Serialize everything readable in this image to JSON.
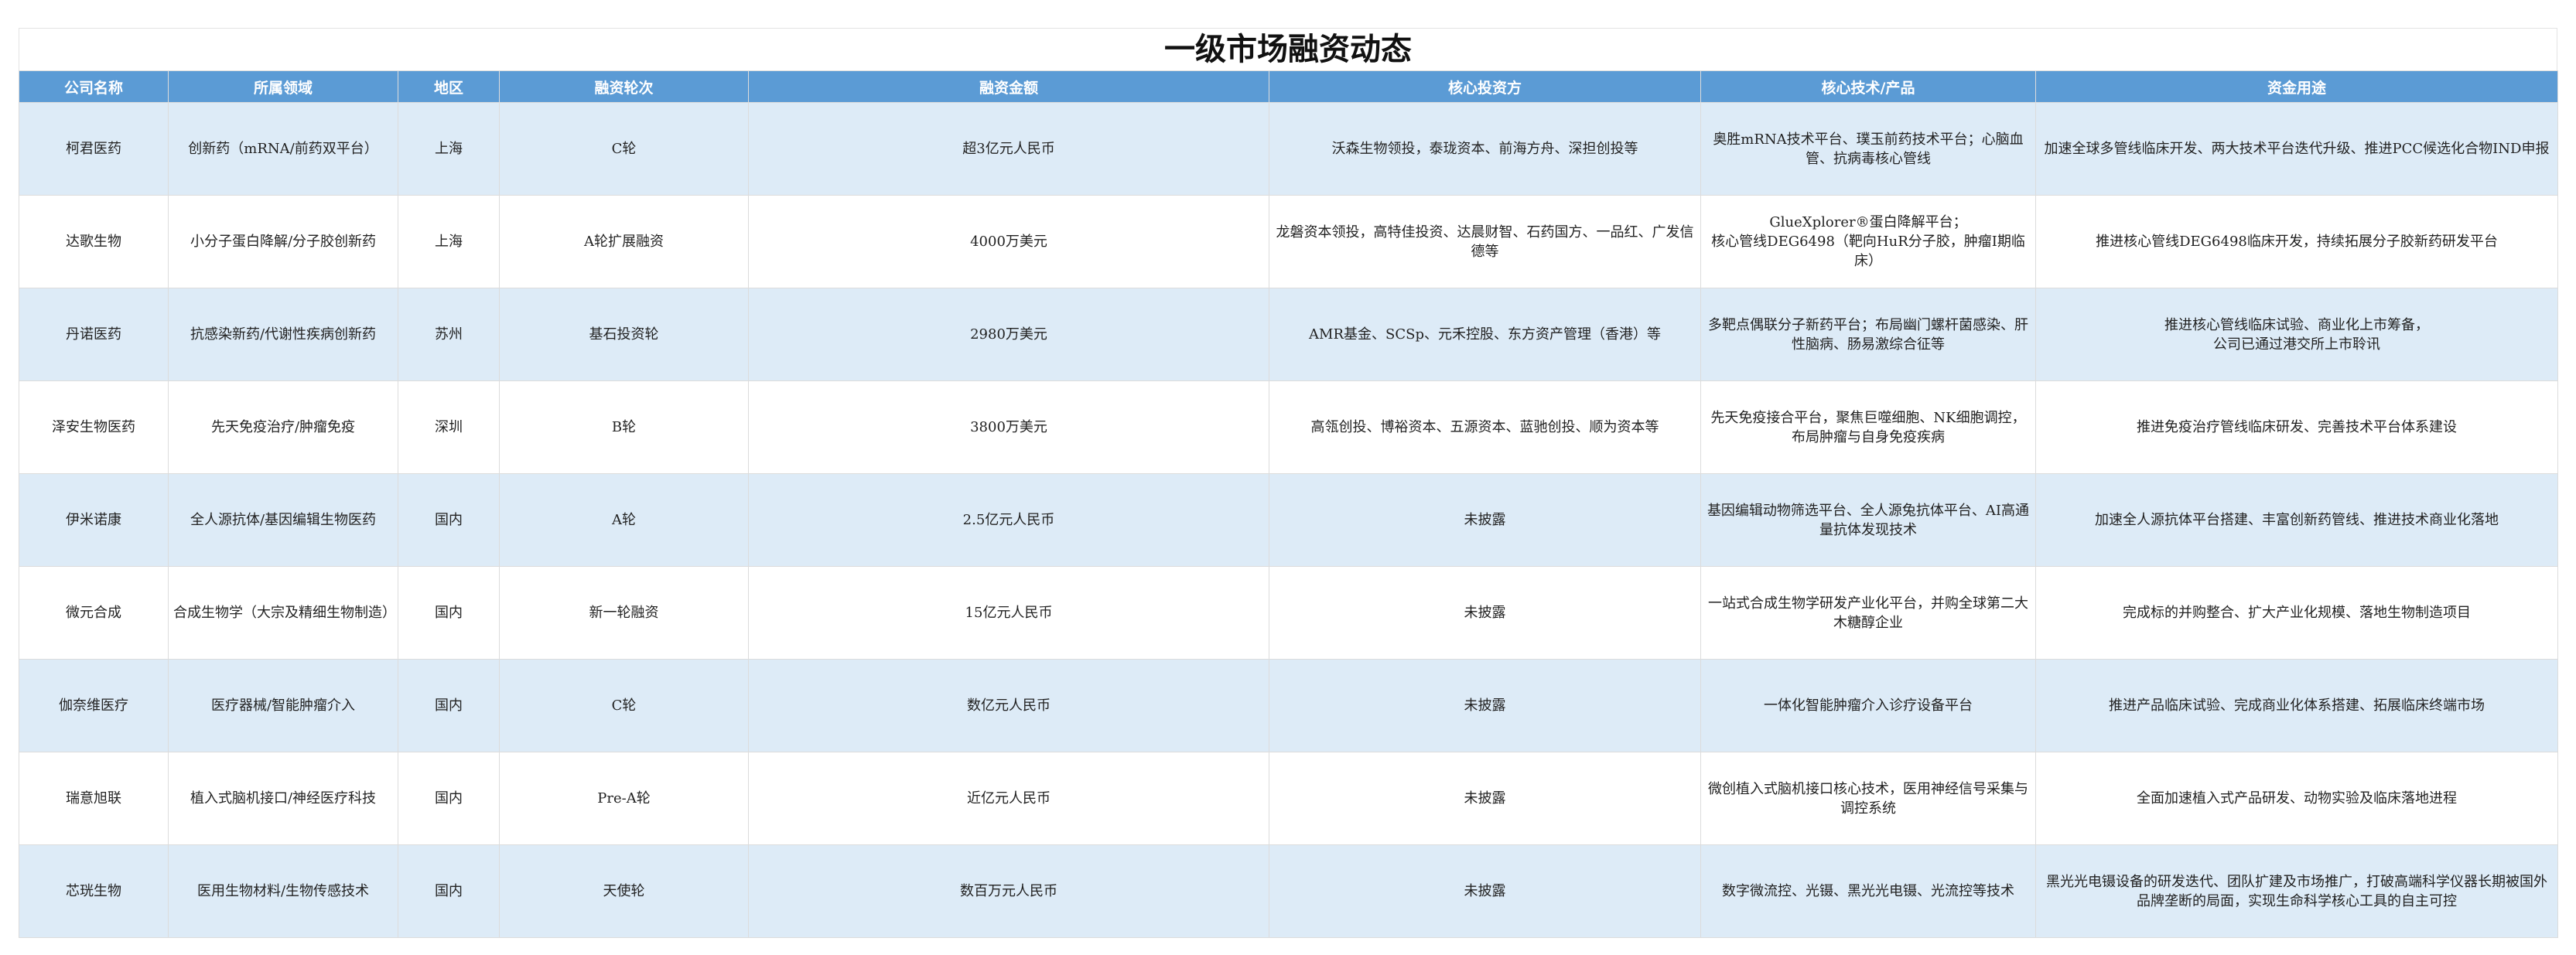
{
  "title": "一级市场融资动态",
  "headers": [
    "公司名称",
    "所属领域",
    "地区",
    "融资轮次",
    "融资金额",
    "核心投资方",
    "核心技术/产品",
    "资金用途"
  ],
  "rows": [
    [
      "柯君医药",
      "创新药（mRNA/前药双平台）",
      "上海",
      "C轮",
      "超3亿元人民币",
      "沃森生物领投，泰珑资本、前海方舟、深担创投等",
      "奥胜mRNA技术平台、璞玉前药技术平台；心脑血管、抗病毒核心管线",
      "加速全球多管线临床开发、两大技术平台迭代升级、推进PCC候选化合物IND申报"
    ],
    [
      "达歌生物",
      "小分子蛋白降解/分子胶创新药",
      "上海",
      "A轮扩展融资",
      "4000万美元",
      "龙磐资本领投，高特佳投资、达晨财智、石药国方、一品红、广发信德等",
      "GlueXplorer®蛋白降解平台；\n核心管线DEG6498（靶向HuR分子胶，肿瘤I期临床）",
      "推进核心管线DEG6498临床开发，持续拓展分子胶新药研发平台"
    ],
    [
      "丹诺医药",
      "抗感染新药/代谢性疾病创新药",
      "苏州",
      "基石投资轮",
      "2980万美元",
      "AMR基金、SCSp、元禾控股、东方资产管理（香港）等",
      "多靶点偶联分子新药平台；布局幽门螺杆菌感染、肝性脑病、肠易激综合征等",
      "推进核心管线临床试验、商业化上市筹备，\n公司已通过港交所上市聆讯"
    ],
    [
      "泽安生物医药",
      "先天免疫治疗/肿瘤免疫",
      "深圳",
      "B轮",
      "3800万美元",
      "高瓴创投、博裕资本、五源资本、蓝驰创投、顺为资本等",
      "先天免疫接合平台，聚焦巨噬细胞、NK细胞调控，布局肿瘤与自身免疫疾病",
      "推进免疫治疗管线临床研发、完善技术平台体系建设"
    ],
    [
      "伊米诺康",
      "全人源抗体/基因编辑生物医药",
      "国内",
      "A轮",
      "2.5亿元人民币",
      "未披露",
      "基因编辑动物筛选平台、全人源兔抗体平台、AI高通量抗体发现技术",
      "加速全人源抗体平台搭建、丰富创新药管线、推进技术商业化落地"
    ],
    [
      "微元合成",
      "合成生物学（大宗及精细生物制造）",
      "国内",
      "新一轮融资",
      "15亿元人民币",
      "未披露",
      "一站式合成生物学研发产业化平台，并购全球第二大木糖醇企业",
      "完成标的并购整合、扩大产业化规模、落地生物制造项目"
    ],
    [
      "伽奈维医疗",
      "医疗器械/智能肿瘤介入",
      "国内",
      "C轮",
      "数亿元人民币",
      "未披露",
      "一体化智能肿瘤介入诊疗设备平台",
      "推进产品临床试验、完成商业化体系搭建、拓展临床终端市场"
    ],
    [
      "瑞意旭联",
      "植入式脑机接口/神经医疗科技",
      "国内",
      "Pre-A轮",
      "近亿元人民币",
      "未披露",
      "微创植入式脑机接口核心技术，医用神经信号采集与调控系统",
      "全面加速植入式产品研发、动物实验及临床落地进程"
    ],
    [
      "芯珖生物",
      "医用生物材料/生物传感技术",
      "国内",
      "天使轮",
      "数百万元人民币",
      "未披露",
      "数字微流控、光镊、黑光光电镊、光流控等技术",
      "黑光光电镊设备的研发迭代、团队扩建及市场推广，打破高端科学仪器长期被国外品牌垄断的局面，实现生命科学核心工具的自主可控"
    ]
  ]
}
